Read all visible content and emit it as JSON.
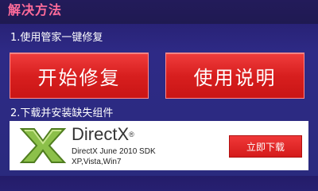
{
  "header": {
    "title": "解决方法"
  },
  "steps": {
    "step1_label": "1.使用管家一键修复",
    "repair_button": "开始修复",
    "manual_button": "使用说明",
    "step2_label": "2.下载并安装缺失组件"
  },
  "component": {
    "name": "DirectX",
    "trademark": "®",
    "version_line": "DirectX June 2010 SDK",
    "os_line": "XP,Vista,Win7",
    "logo_icon": "directx-x-icon"
  },
  "download_button": "立即下载",
  "colors": {
    "background": "#2a2a7e",
    "title": "#ff6b9a",
    "button_red": "#d81f1f",
    "logo_green": "#7fb03a"
  }
}
